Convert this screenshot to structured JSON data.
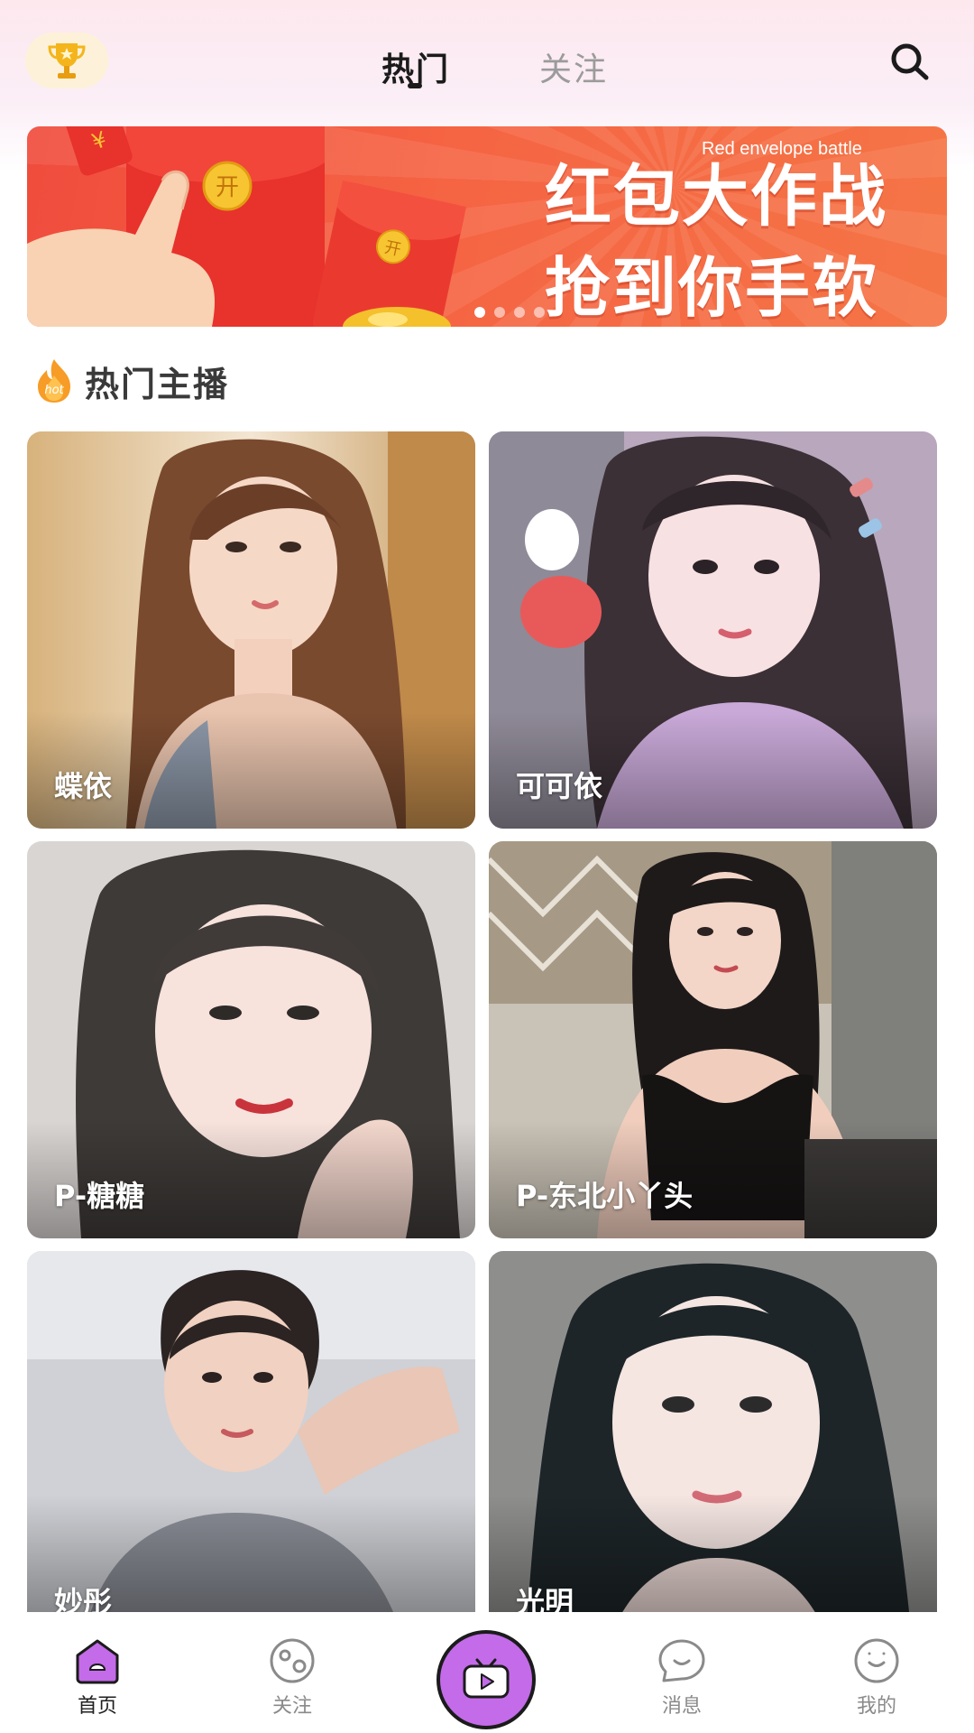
{
  "header": {
    "tabs": [
      {
        "label": "热门",
        "active": true
      },
      {
        "label": "关注",
        "active": false
      }
    ],
    "left_icon": "trophy-icon",
    "right_icon": "search-icon"
  },
  "banner": {
    "title": "红包大作战",
    "subtitle": "Red envelope battle",
    "slogan": "抢到你手软",
    "page_count": 4,
    "active_page": 1
  },
  "section": {
    "title": "热门主播",
    "badge_icon": "hot-flame-icon"
  },
  "streamers": [
    {
      "name": "蝶依"
    },
    {
      "name": "可可依"
    },
    {
      "name": "P-糖糖"
    },
    {
      "name": "P-东北小丫头"
    },
    {
      "name": "妙彤"
    },
    {
      "name": "光明"
    }
  ],
  "bottom_nav": {
    "items": [
      {
        "label": "首页",
        "icon": "home-icon",
        "active": true
      },
      {
        "label": "关注",
        "icon": "follow-icon",
        "active": false
      },
      {
        "label": "",
        "icon": "live-video-icon",
        "active": false
      },
      {
        "label": "消息",
        "icon": "message-icon",
        "active": false
      },
      {
        "label": "我的",
        "icon": "profile-icon",
        "active": false
      }
    ]
  },
  "colors": {
    "accent": "#c36be8",
    "banner": "#f25a40",
    "text_primary": "#1b1b1b",
    "text_secondary": "#9b9b9b"
  }
}
